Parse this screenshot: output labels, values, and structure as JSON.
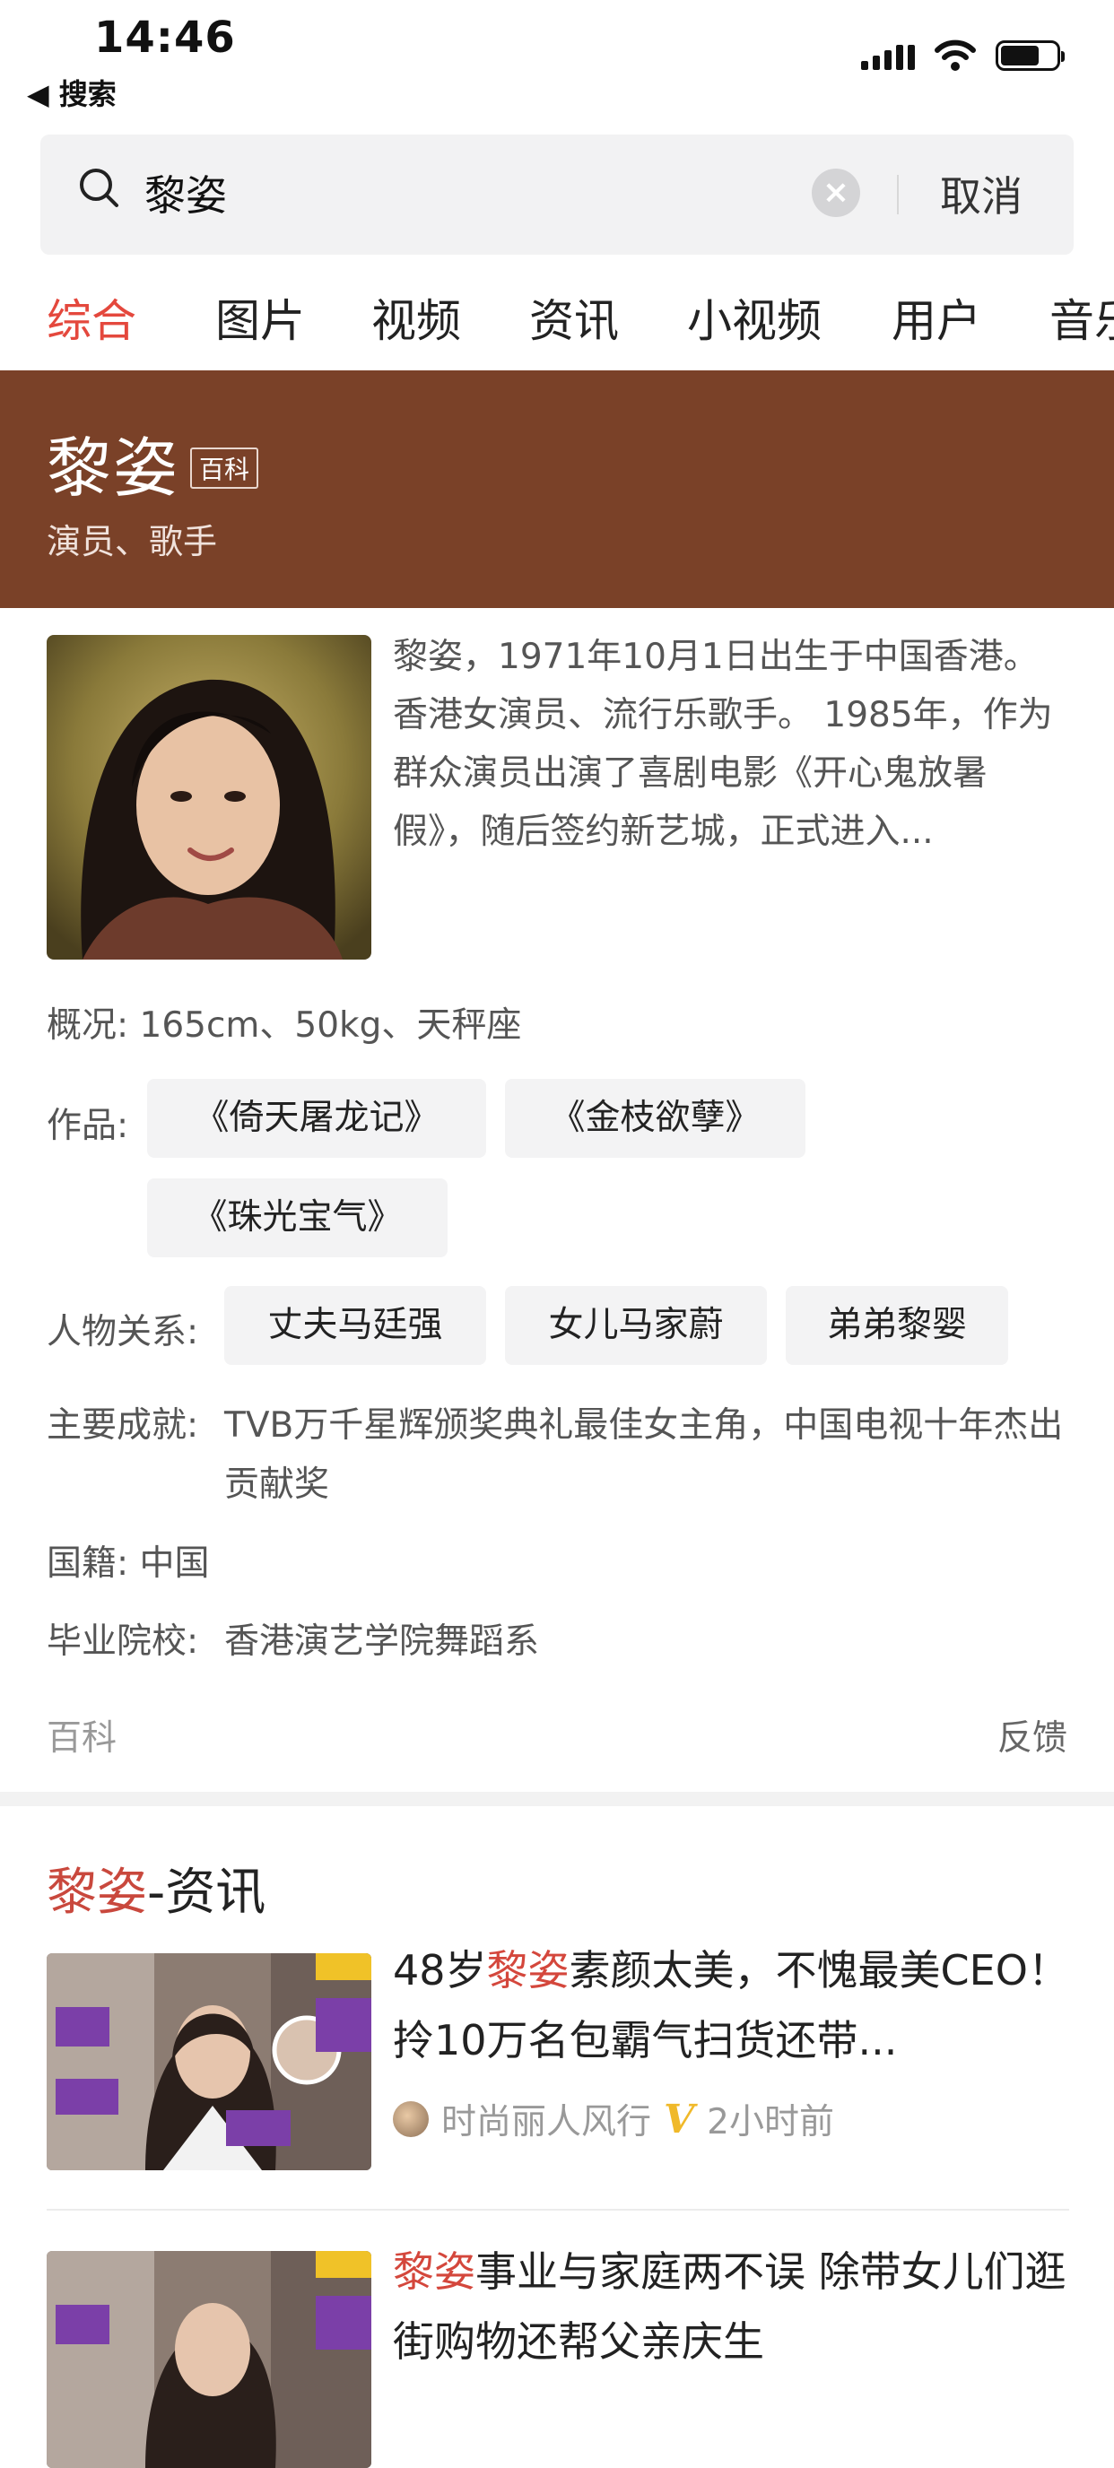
{
  "status": {
    "time": "14:46",
    "back_label": "◀ 搜索"
  },
  "search": {
    "query": "黎姿",
    "cancel_label": "取消"
  },
  "tabs": [
    "综合",
    "图片",
    "视频",
    "资讯",
    "小视频",
    "用户",
    "音乐"
  ],
  "baike": {
    "name": "黎姿",
    "badge": "百科",
    "subtitle": "演员、歌手",
    "intro": "黎姿，1971年10月1日出生于中国香港。香港女演员、流行乐歌手。 1985年，作为群众演员出演了喜剧电影《开心鬼放暑假》，随后签约新艺城，正式进入...",
    "overview_label": "概况:",
    "overview_value": "165cm、50kg、天秤座",
    "works_label": "作品:",
    "works": [
      "《倚天屠龙记》",
      "《金枝欲孽》",
      "《珠光宝气》"
    ],
    "relations_label": "人物关系:",
    "relations": [
      "丈夫马廷强",
      "女儿马家蔚",
      "弟弟黎婴"
    ],
    "achievements_label": "主要成就:",
    "achievements_value": "TVB万千星辉颁奖典礼最佳女主角，中国电视十年杰出贡献奖",
    "nationality_label": "国籍:",
    "nationality_value": "中国",
    "school_label": "毕业院校:",
    "school_value": "香港演艺学院舞蹈系",
    "footer_source": "百科",
    "footer_feedback": "反馈"
  },
  "news": {
    "title_highlight": "黎姿",
    "title_suffix": "-资讯",
    "items": [
      {
        "title_pre": "48岁",
        "title_hl": "黎姿",
        "title_post": "素颜太美，不愧最美CEO！拎10万名包霸气扫货还带...",
        "source": "时尚丽人风行",
        "time": "2小时前"
      },
      {
        "title_pre": "",
        "title_hl": "黎姿",
        "title_post": "事业与家庭两不误 除带女儿们逛街购物还帮父亲庆生"
      }
    ]
  },
  "colors": {
    "accent": "#e4483d",
    "baike_bg": "#7a4128",
    "chip_bg": "#f3f3f4",
    "verified": "#f0b92a"
  }
}
